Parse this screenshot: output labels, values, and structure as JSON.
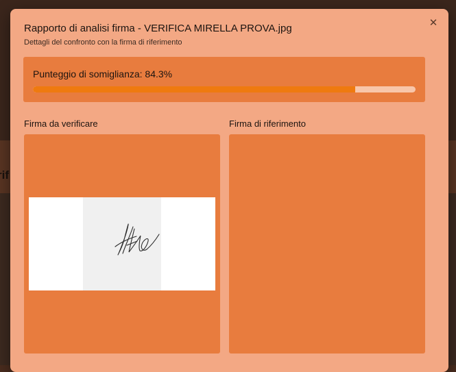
{
  "background": {
    "partial_text": "rif"
  },
  "dialog": {
    "title": "Rapporto di analisi firma - VERIFICA MIRELLA PROVA.jpg",
    "subtitle": "Dettagli del confronto con la firma di riferimento",
    "close_icon": "close-icon",
    "score": {
      "label": "Punteggio di somiglianza: 84.3%",
      "value_percent": 84.3
    },
    "left_panel": {
      "label": "Firma da verificare"
    },
    "right_panel": {
      "label": "Firma di riferimento"
    }
  },
  "colors": {
    "dialog_bg": "#f3a884",
    "panel_bg": "#e87c3e",
    "progress_fill": "#ef7a0f",
    "progress_track": "#f8c6aa"
  }
}
